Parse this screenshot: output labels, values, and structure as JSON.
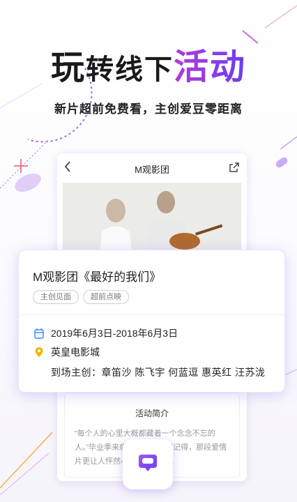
{
  "promo": {
    "headline_part1": "玩",
    "headline_part2": "转线下",
    "headline_accent": "活动",
    "subheadline": "新片超前免费看，主创爱豆零距离"
  },
  "phone": {
    "nav_title": "M观影团",
    "back_icon": "chevron-left-icon",
    "share_icon": "share-icon",
    "description_title": "活动简介",
    "description_text": "“每个人的心里大概都藏着一个念念不忘的人。”毕业季来临，还有谁能够记得，那段爱情片更让人怦然心动的回忆……"
  },
  "event_card": {
    "title": "M观影团《最好的我们》",
    "tags": [
      "主创见面",
      "超前点映"
    ],
    "date": "2019年6月3日-2018年6月3日",
    "location": "英皇电影城",
    "guests_label": "到场主创：",
    "guests": "章笛沙 陈飞宇 何蓝逗 惠英红 汪苏泷"
  },
  "colors": {
    "accent_purple": "#7b3fe4",
    "calendar_blue": "#3d8bfd",
    "pin_yellow": "#f4b400"
  },
  "fab": {
    "icon": "vr-headset-icon"
  }
}
